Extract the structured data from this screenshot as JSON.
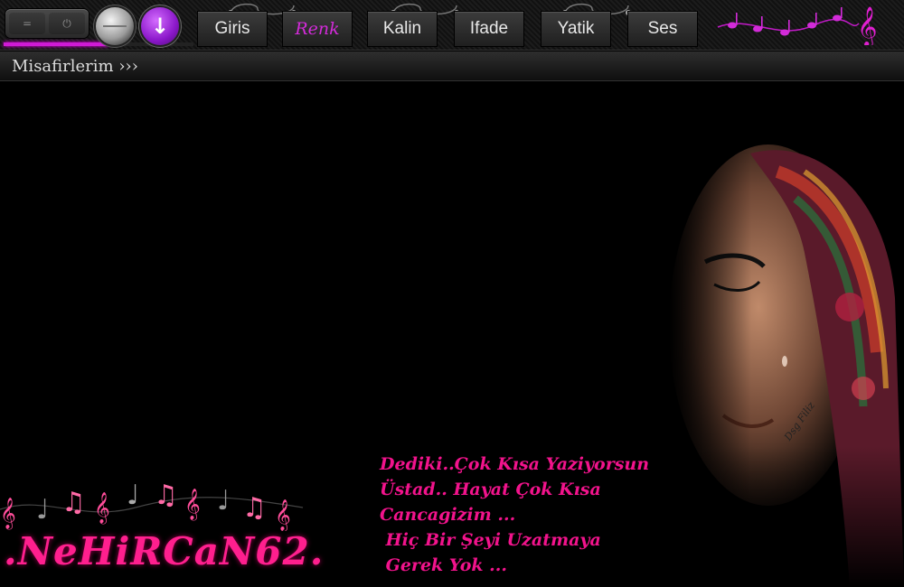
{
  "toolbar": {
    "mode_icons": [
      "equals-icon",
      "power-icon"
    ],
    "mode_glyphs": [
      "=",
      "⏻"
    ],
    "progress_fraction": 0.55,
    "download_glyph": "↓",
    "nav_items": [
      {
        "id": "giris",
        "label": "Giris"
      },
      {
        "id": "renk",
        "label": "Renk",
        "active": true
      },
      {
        "id": "kalin",
        "label": "Kalin"
      },
      {
        "id": "ifade",
        "label": "Ifade"
      },
      {
        "id": "yatik",
        "label": "Yatik"
      },
      {
        "id": "ses",
        "label": "Ses"
      }
    ],
    "logo_icon": "music-notes-icon"
  },
  "guestbar": {
    "label": "Misafirlerim ›››"
  },
  "content": {
    "portrait_icon": "weeping-woman-portrait",
    "portrait_signature": "Dsg Filiz",
    "poem_lines": [
      "Dediki..Çok Kısa Yaziyorsun",
      "Üstad.. Hayat Çok Kısa",
      "Cancagizim ...",
      " Hiç Bir Şeyi Uzatmaya",
      " Gerek Yok ..."
    ],
    "signature": ".NeHiRCaN62.",
    "notes_icon": "music-notes-decoration"
  },
  "colors": {
    "accent": "#d32bd9",
    "poem": "#f2138c",
    "signature": "#ff1f8e"
  }
}
